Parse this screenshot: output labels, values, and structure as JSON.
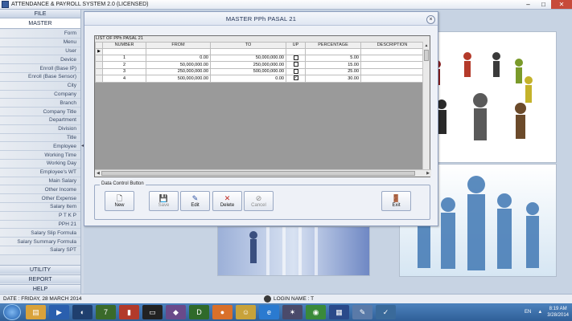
{
  "window": {
    "title": "ATTENDANCE & PAYROLL SYSTEM 2.0 (LICENSED)",
    "minimize": "–",
    "maximize": "□",
    "close": "✕"
  },
  "sidebar": {
    "file": "FILE",
    "master": "MASTER",
    "items": [
      "Form",
      "Menu",
      "User",
      "Device",
      "Enroll (Base IP)",
      "Enroll (Base Sensor)",
      "City",
      "Company",
      "Branch",
      "Company Title",
      "Department",
      "Division",
      "Title",
      "Employee",
      "Working Time",
      "Working Day",
      "Employee's WT",
      "Main Salary",
      "Other Income",
      "Other Expense",
      "Salary Item",
      "P T K P",
      "PPH 21",
      "Salary Slip Formula",
      "Salary Summary Formula",
      "Salary SPT"
    ],
    "utility": "UTILITY",
    "report": "REPORT",
    "help": "HELP"
  },
  "dialog": {
    "title": "MASTER PPh PASAL 21",
    "close": "×",
    "grid_caption": "LIST OF PPh PASAL 21",
    "columns": [
      "NUMBER",
      "FROM",
      "TO",
      "UP",
      "PERCENTAGE",
      "DESCRIPTION"
    ],
    "rows": [
      {
        "number": "1",
        "from": "0.00",
        "to": "50,000,000.00",
        "up": false,
        "percentage": "5.00",
        "description": ""
      },
      {
        "number": "2",
        "from": "50,000,000.00",
        "to": "250,000,000.00",
        "up": false,
        "percentage": "15.00",
        "description": ""
      },
      {
        "number": "3",
        "from": "250,000,000.00",
        "to": "500,000,000.00",
        "up": false,
        "percentage": "25.00",
        "description": ""
      },
      {
        "number": "4",
        "from": "500,000,000.00",
        "to": "0.00",
        "up": true,
        "percentage": "30.00",
        "description": ""
      }
    ],
    "control_label": "Data Control Button",
    "buttons": {
      "new": "New",
      "save": "Save",
      "edit": "Edit",
      "delete": "Delete",
      "cancel": "Cancel",
      "exit": "Exit"
    }
  },
  "status": {
    "date": "DATE : FRIDAY, 28 MARCH 2014",
    "login": "LOGIN NAME :  T"
  },
  "taskbar": {
    "lang": "EN",
    "time": "8:19 AM",
    "date": "3/28/2014"
  },
  "colors": {
    "accent": "#3a5f9e",
    "taskbar": "#3b6ea8",
    "close_button": "#c74a3a"
  }
}
